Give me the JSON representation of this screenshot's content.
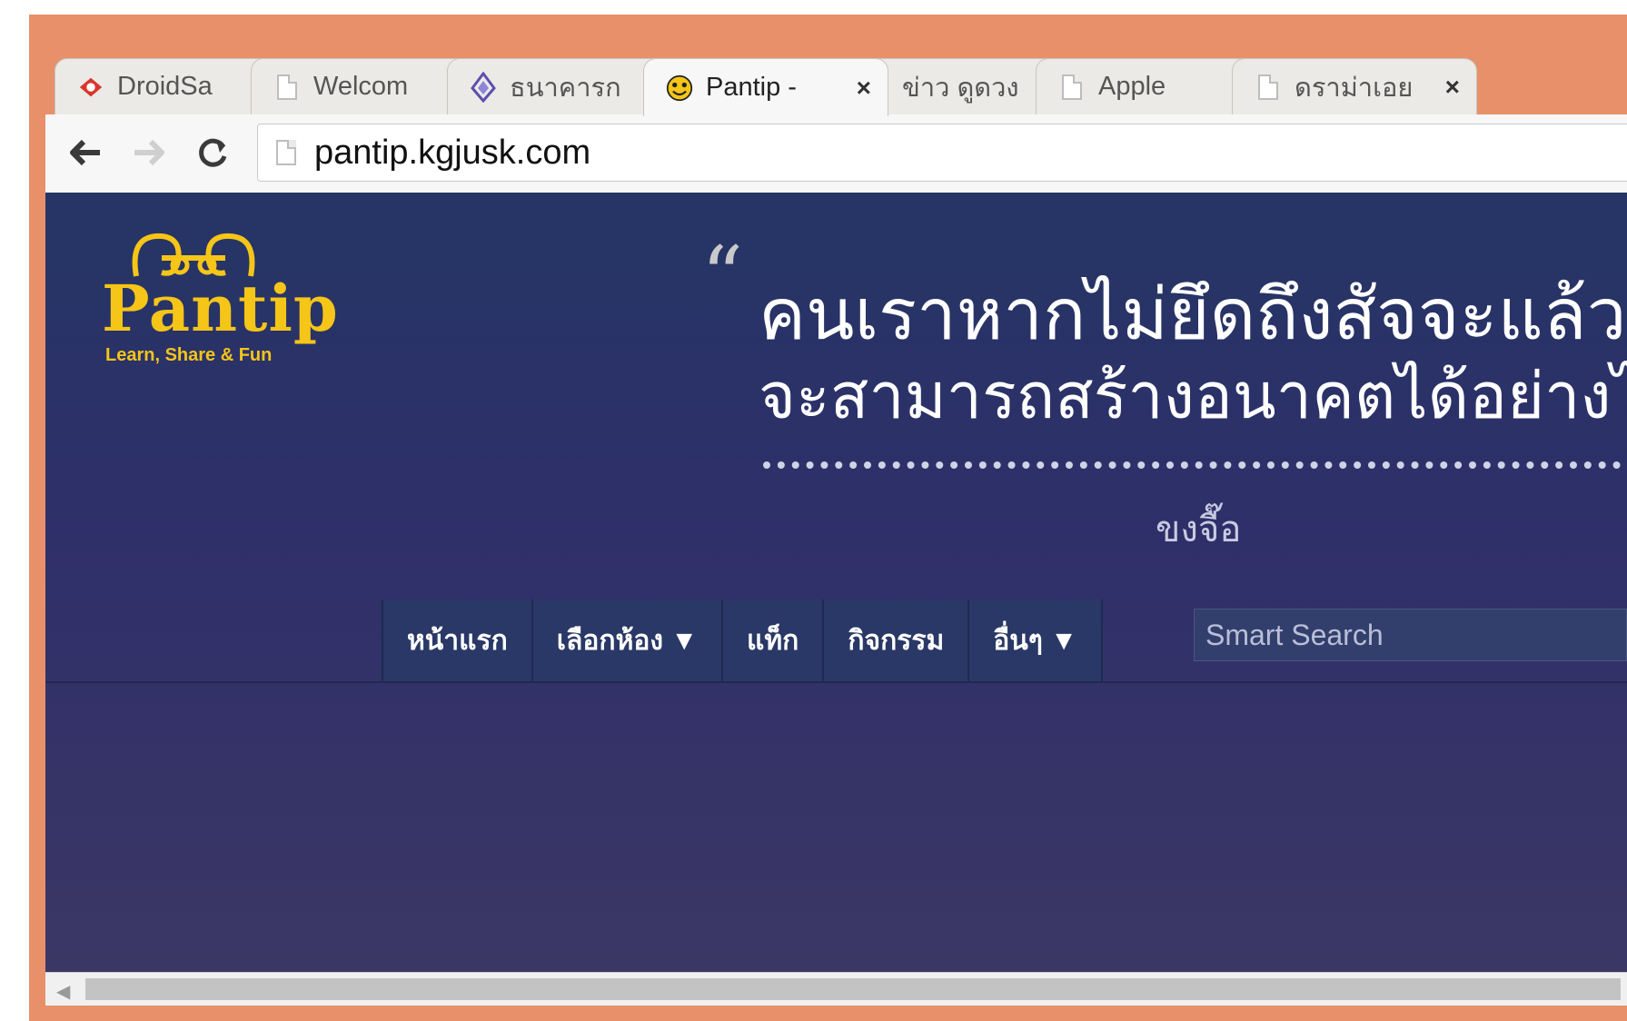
{
  "browser": {
    "tabs": [
      {
        "label": "DroidSa",
        "icon": "droidsans-icon",
        "active": false
      },
      {
        "label": "Welcom",
        "icon": "page-icon",
        "active": false
      },
      {
        "label": "ธนาคารก",
        "icon": "diamond-icon",
        "active": false
      },
      {
        "label": "Pantip -",
        "icon": "pantip-smiley-icon",
        "active": true
      },
      {
        "label": "ข่าว ดูดวง",
        "icon": "page-icon",
        "active": false
      },
      {
        "label": "Apple",
        "icon": "page-icon",
        "active": false
      },
      {
        "label": "ดราม่าเอย",
        "icon": "page-icon",
        "active": false
      }
    ],
    "close_glyph": "×",
    "url": "pantip.kgjusk.com"
  },
  "site": {
    "logo_word": "Pantip",
    "logo_tagline": "Learn, Share & Fun",
    "quote_open": "“",
    "quote_line1": "คนเราหากไม่ยึดถึงสัจจะแล้ว",
    "quote_line2": "จะสามารถสร้างอนาคตได้อย่างไร",
    "quote_author": "ขงจื๊อ",
    "menu": [
      "หน้าแรก",
      "เลือกห้อง ▼",
      "แท็ก",
      "กิจกรรม",
      "อื่นๆ ▼"
    ],
    "search_placeholder": "Smart Search"
  },
  "colors": {
    "frame": "#e8906a",
    "header_bg": "#253565",
    "logo": "#f5c518"
  }
}
